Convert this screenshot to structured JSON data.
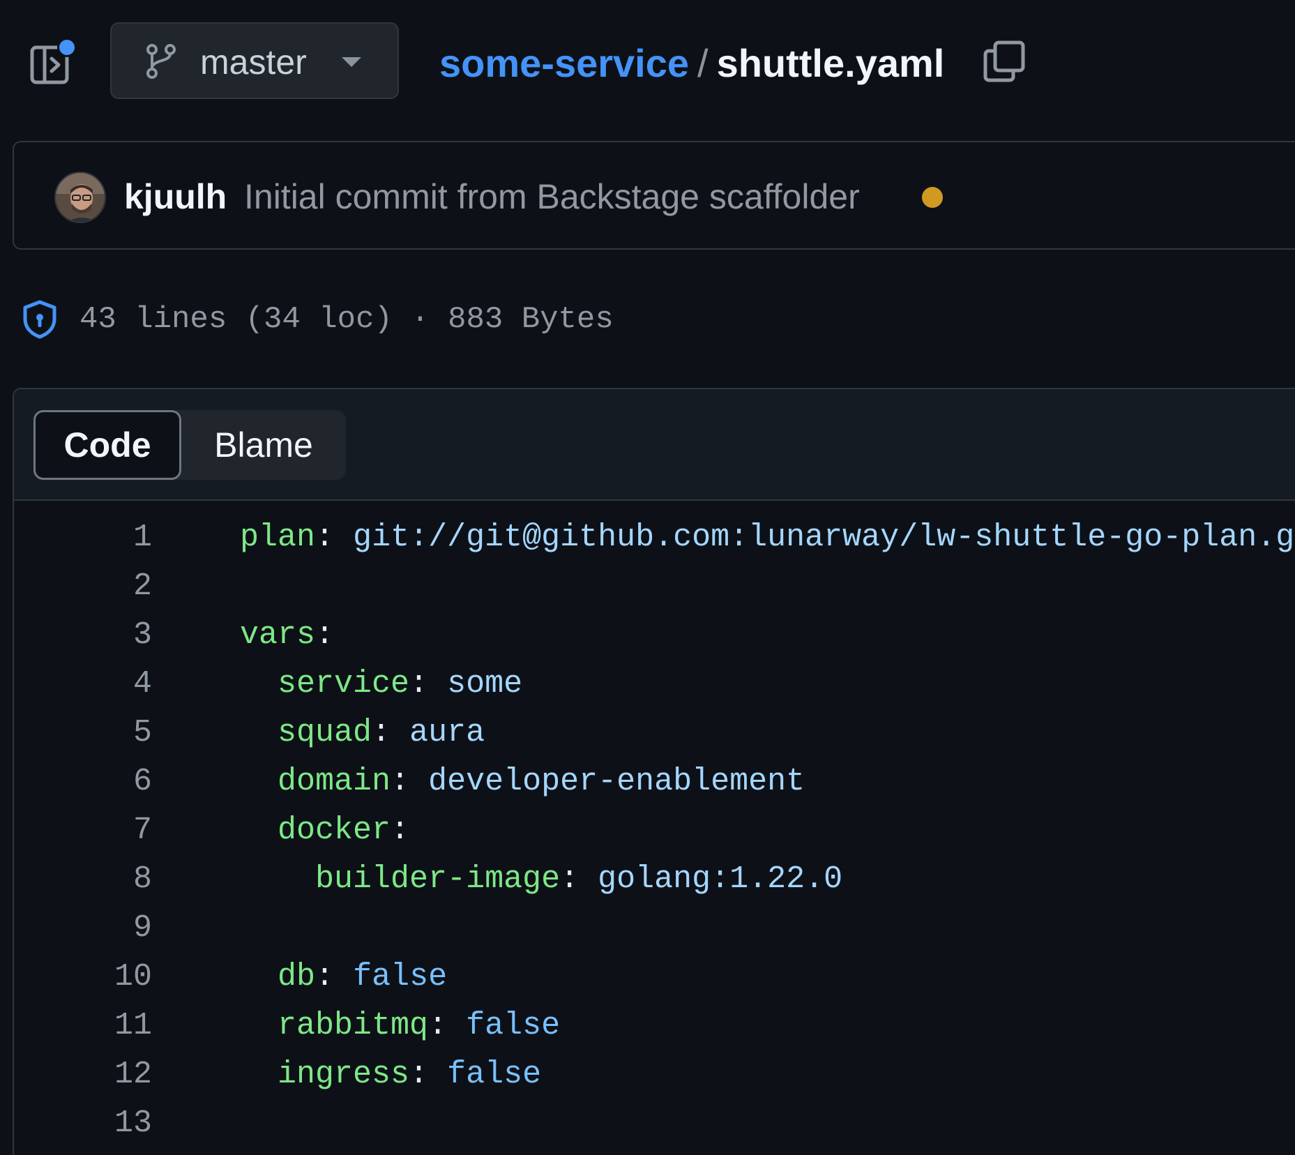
{
  "topbar": {
    "sidebar_toggle_icon": "sidebar-expand-icon",
    "notification_dot_color": "#4493f8",
    "branch": "master",
    "branch_icon": "git-branch-icon",
    "repo": "some-service",
    "separator": "/",
    "file": "shuttle.yaml",
    "copy_icon": "copy-icon"
  },
  "commit": {
    "author": "kjuulh",
    "message": "Initial commit from Backstage scaffolder",
    "status_color": "#d29922"
  },
  "file_info": {
    "icon": "shield-lock-icon",
    "stats": "43 lines (34 loc) · 883 Bytes"
  },
  "tabs": {
    "code": "Code",
    "blame": "Blame",
    "active": "Code"
  },
  "code": [
    {
      "n": "1",
      "indent": "",
      "key": "plan",
      "value": "git://git@github.com:lunarway/lw-shuttle-go-plan.git",
      "vtype": "str"
    },
    {
      "n": "2",
      "indent": "",
      "key": "",
      "value": "",
      "vtype": ""
    },
    {
      "n": "3",
      "indent": "",
      "key": "vars",
      "value": "",
      "vtype": ""
    },
    {
      "n": "4",
      "indent": "  ",
      "key": "service",
      "value": "some",
      "vtype": "str"
    },
    {
      "n": "5",
      "indent": "  ",
      "key": "squad",
      "value": "aura",
      "vtype": "str"
    },
    {
      "n": "6",
      "indent": "  ",
      "key": "domain",
      "value": "developer-enablement",
      "vtype": "str"
    },
    {
      "n": "7",
      "indent": "  ",
      "key": "docker",
      "value": "",
      "vtype": ""
    },
    {
      "n": "8",
      "indent": "    ",
      "key": "builder-image",
      "value": "golang:1.22.0",
      "vtype": "str"
    },
    {
      "n": "9",
      "indent": "",
      "key": "",
      "value": "",
      "vtype": ""
    },
    {
      "n": "10",
      "indent": "  ",
      "key": "db",
      "value": "false",
      "vtype": "bool"
    },
    {
      "n": "11",
      "indent": "  ",
      "key": "rabbitmq",
      "value": "false",
      "vtype": "bool"
    },
    {
      "n": "12",
      "indent": "  ",
      "key": "ingress",
      "value": "false",
      "vtype": "bool"
    },
    {
      "n": "13",
      "indent": "",
      "key": "",
      "value": "",
      "vtype": ""
    }
  ]
}
